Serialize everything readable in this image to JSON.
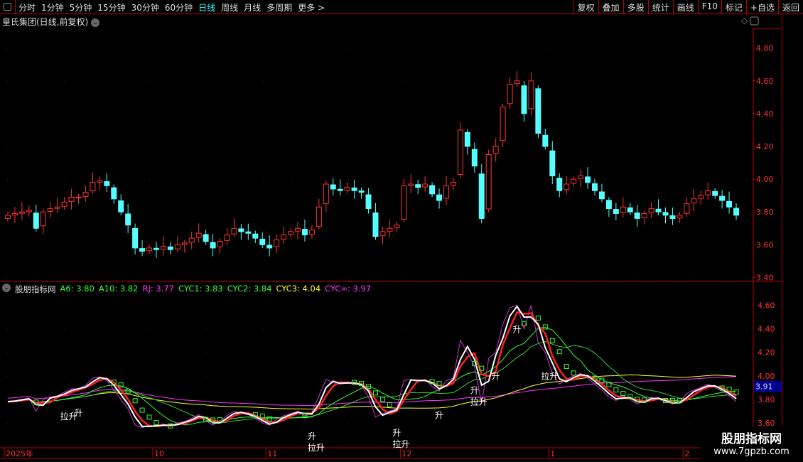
{
  "toolbar": {
    "periods": [
      "分时",
      "1分钟",
      "5分钟",
      "15分钟",
      "30分钟",
      "60分钟",
      "日线",
      "周线",
      "月线",
      "多周期",
      "更多 >"
    ],
    "active": "日线",
    "tools": [
      "复权",
      "叠加",
      "多股",
      "统计",
      "画线",
      "F10",
      "标记",
      "+自选",
      "返回"
    ]
  },
  "title": "皇氏集团(日线,前复权)",
  "indicator": {
    "name": "股朋指标网",
    "values": [
      {
        "label": "A6: 3.80",
        "color": "#3f3"
      },
      {
        "label": "A10: 3.82",
        "color": "#3f3"
      },
      {
        "label": "RJ: 3.77",
        "color": "#f3f"
      },
      {
        "label": "CYC1: 3.83",
        "color": "#3f3"
      },
      {
        "label": "CYC2: 3.84",
        "color": "#3f3"
      },
      {
        "label": "CYC3: 4.04",
        "color": "#ff3"
      },
      {
        "label": "CYC∞: 3.97",
        "color": "#f3f"
      }
    ],
    "current": "3.91"
  },
  "watermark": {
    "line1": "股朋指标网",
    "line2": "www.7gpzb.com"
  },
  "chart_data": {
    "type": "candlestick",
    "price_axis": {
      "ticks": [
        3.4,
        3.6,
        3.8,
        4.0,
        4.2,
        4.4,
        4.6,
        4.8
      ],
      "range": [
        3.38,
        4.92
      ]
    },
    "indicator_axis": {
      "ticks": [
        3.6,
        3.8,
        4.0,
        4.2,
        4.4,
        4.6
      ],
      "range": [
        3.4,
        4.7
      ]
    },
    "date_labels": [
      {
        "i": 0,
        "t": "2025年"
      },
      {
        "i": 21,
        "t": "10"
      },
      {
        "i": 37,
        "t": "11"
      },
      {
        "i": 56,
        "t": "12"
      },
      {
        "i": 77,
        "t": "1"
      },
      {
        "i": 96,
        "t": "2"
      }
    ],
    "closes": [
      3.78,
      3.79,
      3.8,
      3.81,
      3.7,
      3.8,
      3.82,
      3.83,
      3.86,
      3.89,
      3.89,
      3.92,
      3.98,
      3.99,
      3.96,
      3.88,
      3.8,
      3.72,
      3.58,
      3.56,
      3.58,
      3.57,
      3.59,
      3.57,
      3.6,
      3.61,
      3.64,
      3.67,
      3.62,
      3.58,
      3.62,
      3.66,
      3.7,
      3.68,
      3.67,
      3.64,
      3.6,
      3.58,
      3.63,
      3.66,
      3.68,
      3.7,
      3.66,
      3.69,
      3.83,
      3.97,
      3.94,
      3.93,
      3.95,
      3.93,
      3.92,
      3.82,
      3.65,
      3.68,
      3.7,
      3.72,
      3.96,
      3.97,
      3.95,
      3.97,
      3.91,
      3.87,
      3.96,
      3.98,
      4.3,
      4.2,
      4.08,
      3.76,
      4.15,
      4.2,
      4.44,
      4.58,
      4.6,
      4.4,
      4.6,
      4.28,
      4.2,
      4.02,
      3.93,
      3.97,
      4.0,
      4.02,
      3.98,
      3.93,
      3.88,
      3.82,
      3.79,
      3.83,
      3.8,
      3.76,
      3.79,
      3.82,
      3.8,
      3.78,
      3.76,
      3.78,
      3.85,
      3.88,
      3.9,
      3.93,
      3.9,
      3.87,
      3.83,
      3.78
    ],
    "signals": [
      {
        "i": 10,
        "t": "升"
      },
      {
        "i": 8,
        "t": "拉升"
      },
      {
        "i": 43,
        "t": "升"
      },
      {
        "i": 43,
        "t": "拉升"
      },
      {
        "i": 55,
        "t": "升"
      },
      {
        "i": 55,
        "t": "拉升"
      },
      {
        "i": 61,
        "t": "升"
      },
      {
        "i": 66,
        "t": "升"
      },
      {
        "i": 66,
        "t": "拉升"
      },
      {
        "i": 69,
        "t": "升"
      },
      {
        "i": 72,
        "t": "升"
      },
      {
        "i": 76,
        "t": "拉升"
      }
    ],
    "colors": {
      "up": "#ff3232",
      "down": "#54ffff",
      "a6": "#ffffff",
      "a10": "#ff2020",
      "cyc1": "#3f3",
      "cyc2": "#3c3",
      "cyc3": "#ff3",
      "cycinf": "#f3f",
      "rj": "#c3c"
    }
  }
}
